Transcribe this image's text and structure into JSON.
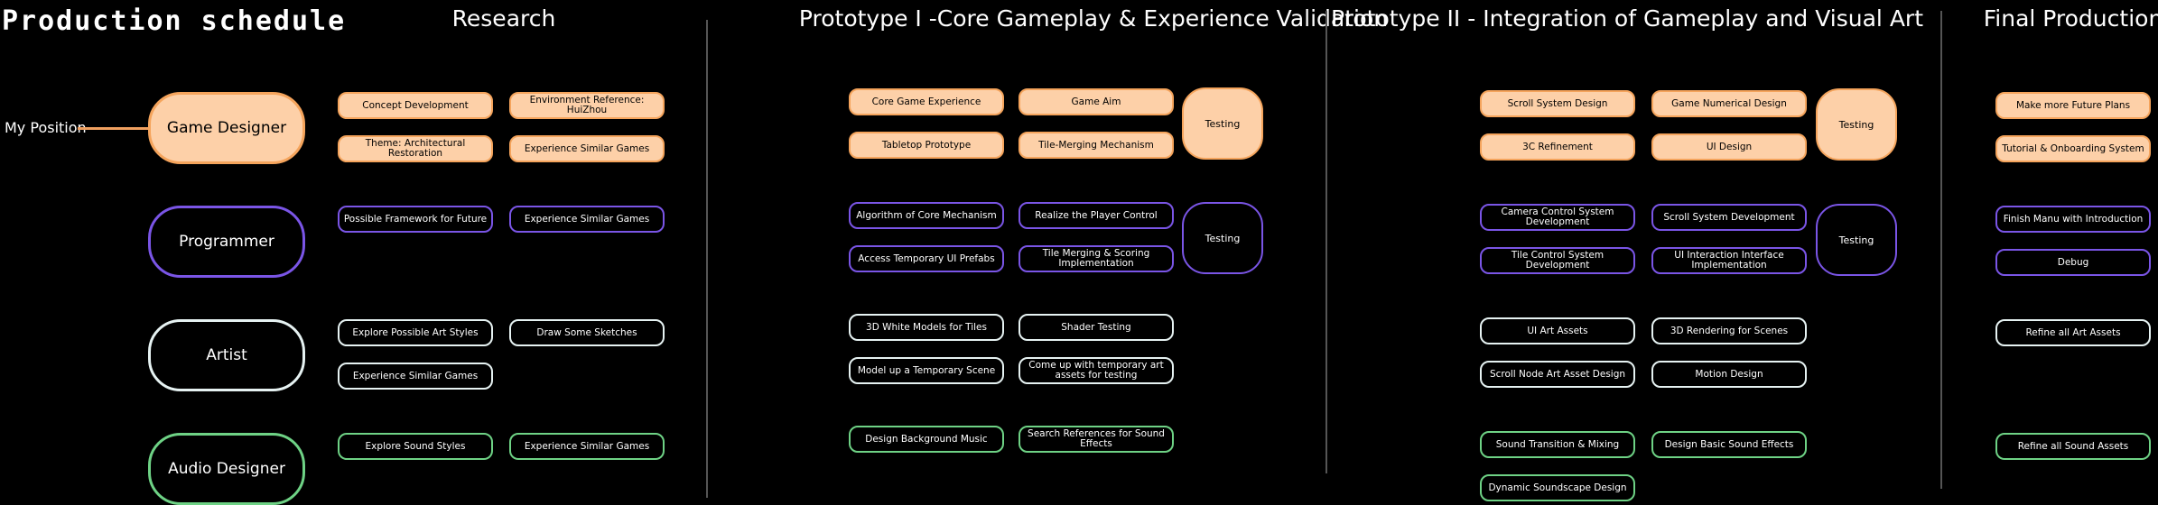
{
  "title": "Production schedule",
  "my_position": "My Position",
  "phases": {
    "research": "Research",
    "proto1": "Prototype I -Core Gameplay & Experience Validation",
    "proto2": "Prototype II - Integration of Gameplay and Visual Art",
    "final": "Final Production"
  },
  "roles": {
    "game_designer": "Game Designer",
    "programmer": "Programmer",
    "artist": "Artist",
    "audio_designer": "Audio Designer"
  },
  "research": {
    "gd": [
      "Concept Development",
      "Environment Reference: HuiZhou",
      "Theme: Architectural Restoration",
      "Experience Similar Games"
    ],
    "pg": [
      "Possible Framework for Future",
      "Experience Similar Games"
    ],
    "ar": [
      "Explore Possible Art Styles",
      "Draw Some Sketches",
      "Experience Similar Games"
    ],
    "au": [
      "Explore Sound Styles",
      "Experience Similar Games"
    ]
  },
  "proto1": {
    "gd": [
      "Core Game Experience",
      "Game Aim",
      "Tabletop Prototype",
      "Tile-Merging Mechanism"
    ],
    "pg": [
      "Algorithm of Core Mechanism",
      "Realize the Player Control",
      "Access Temporary UI Prefabs",
      "Tile Merging & Scoring Implementation"
    ],
    "ar": [
      "3D White Models for Tiles",
      "Shader Testing",
      "Model up a Temporary Scene",
      "Come up with temporary art assets for testing"
    ],
    "au": [
      "Design Background Music",
      "Search References for Sound Effects"
    ],
    "testing_gd": "Testing",
    "testing_pg": "Testing"
  },
  "proto2": {
    "gd": [
      "Scroll System Design",
      "Game Numerical Design",
      "3C Refinement",
      "UI Design"
    ],
    "pg": [
      "Camera Control System Development",
      "Scroll System Development",
      "Tile Control System Development",
      "UI Interaction Interface Implementation"
    ],
    "ar": [
      "UI Art Assets",
      "3D Rendering for Scenes",
      "Scroll Node Art Asset Design",
      "Motion Design"
    ],
    "au": [
      "Sound Transition & Mixing",
      "Design Basic Sound Effects",
      "Dynamic Soundscape Design"
    ],
    "testing_gd": "Testing",
    "testing_pg": "Testing"
  },
  "final": {
    "gd": [
      "Make more Future Plans",
      "Tutorial & Onboarding System"
    ],
    "pg": [
      "Finish Manu with Introduction",
      "Debug"
    ],
    "ar": [
      "Refine all Art Assets"
    ],
    "au": [
      "Refine all Sound Assets"
    ]
  },
  "colors": {
    "game_designer": "#f5a45c",
    "game_designer_fill": "#fdd0a8",
    "programmer": "#7a55e6",
    "artist": "#e6f2f2",
    "audio_designer": "#6ed285",
    "divider": "#555555"
  }
}
